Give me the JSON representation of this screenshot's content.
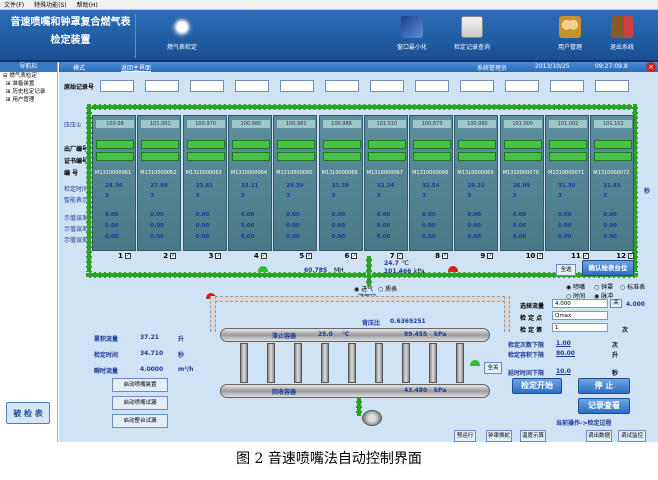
{
  "menu": [
    "文件(F)",
    "特殊功能(S)",
    "帮助(H)"
  ],
  "header": {
    "title_line1": "音速喷嘴和钟罩复合燃气表",
    "title_line2": "检定装置",
    "buttons": [
      "燃气表检定",
      "窗口最小化",
      "检定记录查询",
      "用户管理",
      "退出系统"
    ]
  },
  "nav": {
    "head": "导航栏",
    "items": [
      "燃气表检定",
      "准备装置",
      "历史检定记录",
      "用户管理"
    ],
    "verify_button": "被 检 表"
  },
  "toolbar": {
    "mode": "模式",
    "back": "返回主界面",
    "system": "系统管理员",
    "date": "2013/10/25",
    "time": "09:27:09.8"
  },
  "record": {
    "label": "原始记录号"
  },
  "left_labels": {
    "pressure": "压压①",
    "serial": "出厂编号",
    "cert": "证书编号",
    "code": "编  号",
    "verify_time": "检定时间",
    "flow_nominal": "智能表示",
    "err1": "示值误差(大)",
    "err2": "示值误差(中)",
    "err3": "示值误差(小)"
  },
  "meters": [
    {
      "num": "1",
      "top": "100.08",
      "serial": "M1310000061",
      "time": "28.36",
      "v": "3"
    },
    {
      "num": "2",
      "top": "101.001",
      "serial": "M1310000062",
      "time": "27.98",
      "v": "3"
    },
    {
      "num": "3",
      "top": "100.970",
      "serial": "M1310000063",
      "time": "33.81",
      "v": "3"
    },
    {
      "num": "4",
      "top": "100.980",
      "serial": "M1310000064",
      "time": "33.11",
      "v": "3"
    },
    {
      "num": "5",
      "top": "100.981",
      "serial": "M1310000065",
      "time": "29.39",
      "v": "3"
    },
    {
      "num": "6",
      "top": "100.988",
      "serial": "M1310000066",
      "time": "33.39",
      "v": "3"
    },
    {
      "num": "7",
      "top": "101.010",
      "serial": "M1310000067",
      "time": "32.24",
      "v": "3"
    },
    {
      "num": "8",
      "top": "100.873",
      "serial": "M1310000068",
      "time": "32.54",
      "v": "3"
    },
    {
      "num": "9",
      "top": "100.980",
      "serial": "M1310000069",
      "time": "29.31",
      "v": "3"
    },
    {
      "num": "10",
      "top": "101.000",
      "serial": "M1310000070",
      "time": "26.99",
      "v": "3"
    },
    {
      "num": "11",
      "top": "101.002",
      "serial": "M1310000071",
      "time": "31.30",
      "v": "3"
    },
    {
      "num": "12",
      "top": "101.102",
      "serial": "M1310000072",
      "time": "31.83",
      "v": "3"
    }
  ],
  "err_values": "0.00",
  "side_unit": "秒",
  "flow": {
    "left_value": "60.785",
    "left_unit": "MH",
    "temp": "24.7",
    "temp_unit": "℃",
    "pressure": "101.466",
    "pressure_unit": "kPa",
    "inlet": "进气口",
    "inlet_gas": "进气",
    "bell": "质表",
    "all_select": "全选",
    "confirm": "确认检表台位"
  },
  "tanks": {
    "stag_pressure_label": "背压比",
    "stag_pressure": "0.6369251",
    "upper_label": "滞止容器",
    "upper_temp": "25.0",
    "upper_temp_unit": "℃",
    "upper_pressure": "99.455",
    "upper_pressure_unit": "kPa",
    "lower_label": "回收容器",
    "lower_pressure": "43.480",
    "lower_pressure_unit": "kPa",
    "full_open": "全关"
  },
  "left_info": [
    {
      "label": "累积流量",
      "value": "37.21",
      "unit": "升"
    },
    {
      "label": "检定时间",
      "value": "34.710",
      "unit": "秒"
    },
    {
      "label": "瞬时流量",
      "value": "4.0000",
      "unit": "m³/h"
    }
  ],
  "left_buttons": [
    "启动喷嘴装置",
    "启动喷嘴试漏",
    "启动整台试漏"
  ],
  "right_panel": {
    "radios": [
      "喷嘴",
      "钟罩",
      "标准表"
    ],
    "radios2": [
      "时间",
      "脉冲"
    ],
    "select_flow_label": "选择流量",
    "select_flow_value": "4.000",
    "select_flow_btn": "关",
    "select_flow_right": "4.000",
    "check_point_label": "检 定 点",
    "check_point_value": "Qmax",
    "check_count_label": "检 定 第",
    "check_count_value": "1",
    "check_count_unit": "次",
    "set_count_label": "检定次数下限",
    "set_count_value": "1.00",
    "set_count_unit": "次",
    "volume_label": "检定容积下限",
    "volume_value": "80.00",
    "volume_unit": "升",
    "delay_label": "延时时间下限",
    "delay_value": "10.0",
    "delay_unit": "秒",
    "start": "检定开始",
    "stop": "停  止",
    "records": "记录查看",
    "current_op": "当前操作->检定过程"
  },
  "bottom_buttons": [
    "预运行",
    "钟罩换蛇",
    "温度示算",
    "调出数据",
    "调试监控"
  ],
  "caption": "图 2  音速喷嘴法自动控制界面"
}
